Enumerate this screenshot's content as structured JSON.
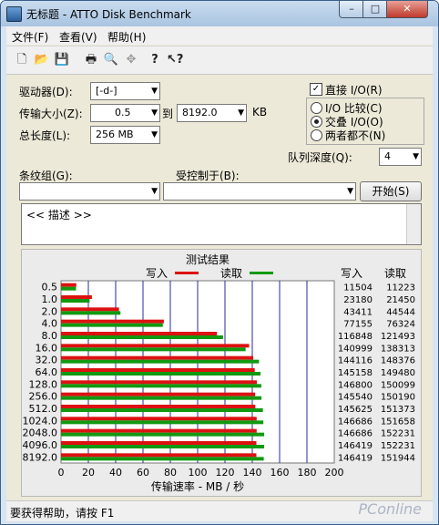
{
  "window": {
    "title": "无标题 - ATTO Disk Benchmark"
  },
  "title_buttons": {
    "minimize": "–",
    "maximize": "□",
    "close": "✕"
  },
  "menu": [
    "文件(F)",
    "查看(V)",
    "帮助(H)"
  ],
  "toolbar_icons": [
    "new-file-icon",
    "open-folder-icon",
    "save-icon",
    "print-icon",
    "print-preview-icon",
    "move-icon",
    "help-icon",
    "context-help-icon"
  ],
  "settings": {
    "drive_label": "驱动器(D):",
    "drive_value": "[-d-]",
    "transfer_label": "传输大小(Z):",
    "transfer_from": "0.5",
    "transfer_to_label": "到",
    "transfer_to": "8192.0",
    "transfer_unit": "KB",
    "total_label": "总长度(L):",
    "total_value": "256 MB",
    "direct_io_label": "直接 I/O(R)",
    "direct_io_checked": true,
    "io_compare_label": "I/O 比较(C)",
    "overlapped_io_label": "交叠 I/O(O)",
    "neither_label": "两者都不(N)",
    "selected_mode": "overlapped",
    "queue_label": "队列深度(Q):",
    "queue_value": "4",
    "stripe_label": "条纹组(G):",
    "controlled_label": "受控制于(B):",
    "start_button": "开始(S)",
    "description": "<< 描述 >>"
  },
  "chart_data": {
    "type": "bar",
    "title": "测试结果",
    "legend": [
      {
        "name": "写入",
        "color": "#dd1111"
      },
      {
        "name": "读取",
        "color": "#119911"
      }
    ],
    "xlabel": "传输速率 - MB / 秒",
    "xlim": [
      0,
      200
    ],
    "xticks": [
      0,
      20,
      40,
      60,
      80,
      100,
      120,
      140,
      160,
      180,
      200
    ],
    "categories": [
      "0.5",
      "1.0",
      "2.0",
      "4.0",
      "8.0",
      "16.0",
      "32.0",
      "64.0",
      "128.0",
      "256.0",
      "512.0",
      "1024.0",
      "2048.0",
      "4096.0",
      "8192.0"
    ],
    "write_header": "写入",
    "read_header": "读取",
    "write_kbps": [
      11504,
      23180,
      43411,
      77155,
      116848,
      140999,
      144116,
      145158,
      146800,
      145540,
      145625,
      146686,
      146686,
      146419,
      146419
    ],
    "read_kbps": [
      11223,
      21450,
      44544,
      76324,
      121493,
      138313,
      148376,
      149480,
      150099,
      150190,
      151373,
      151658,
      152231,
      152231,
      151944
    ],
    "series": [
      {
        "name": "写入",
        "values": [
          11.2,
          22.6,
          42.4,
          75.3,
          114.1,
          137.7,
          140.7,
          141.8,
          143.4,
          142.1,
          142.2,
          143.2,
          143.2,
          143.0,
          143.0
        ]
      },
      {
        "name": "读取",
        "values": [
          11.0,
          20.9,
          43.5,
          74.5,
          118.6,
          135.1,
          144.9,
          146.0,
          146.6,
          146.7,
          147.8,
          148.1,
          148.7,
          148.7,
          148.4
        ]
      }
    ],
    "grid": true
  },
  "status": "要获得帮助，请按 F1",
  "watermark": "PConline"
}
